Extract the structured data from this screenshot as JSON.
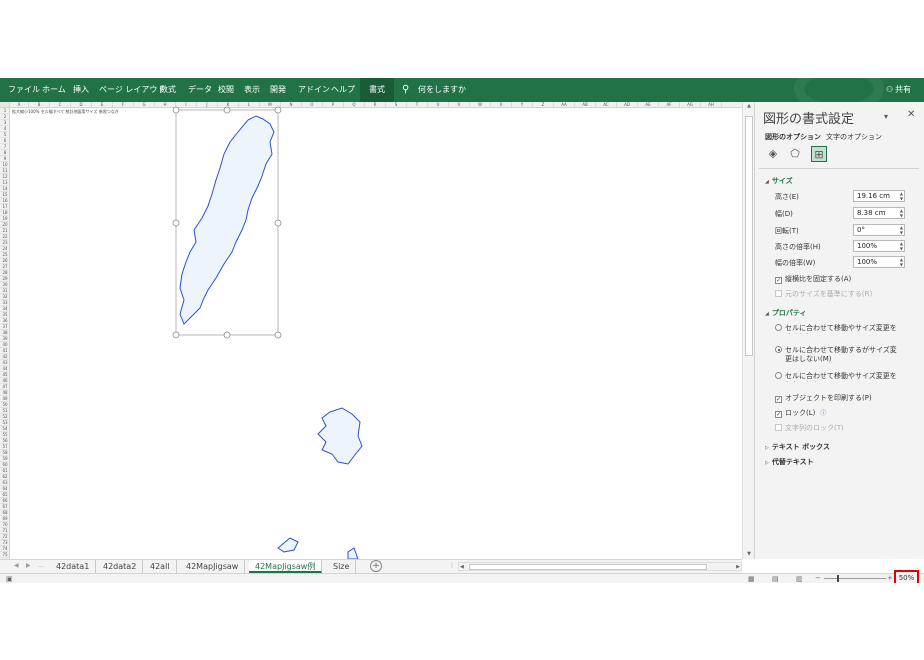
{
  "ribbon": {
    "tabs": [
      "ファイル",
      "ホーム",
      "挿入",
      "ページ レイアウト",
      "数式",
      "データ",
      "校閲",
      "表示",
      "開発",
      "アドイン",
      "ヘルプ",
      "書式"
    ],
    "active_tab": "書式",
    "tell_me": "何をしますか",
    "share": "共有",
    "accent_color": "#217346"
  },
  "sheet": {
    "columns": [
      "A",
      "B",
      "C",
      "D",
      "E",
      "F",
      "G",
      "H",
      "I",
      "J",
      "K",
      "L",
      "M",
      "N",
      "O",
      "P",
      "Q",
      "R",
      "S",
      "T",
      "U",
      "V",
      "W",
      "X",
      "Y",
      "Z",
      "AA",
      "AB",
      "AC",
      "AD",
      "AE",
      "AF",
      "AG",
      "AH"
    ],
    "note": "拡大縮小100%  セル幅すべて  統計地図用サイズ  参照つなぎ"
  },
  "pane": {
    "title": "図形の書式設定",
    "tabs": [
      "図形のオプション",
      "文字のオプション"
    ],
    "icons": [
      "fill-line-icon",
      "effects-icon",
      "size-properties-icon"
    ],
    "size_section": "サイズ",
    "height_label": "高さ(E)",
    "height_value": "19.16 cm",
    "width_label": "幅(D)",
    "width_value": "8.38 cm",
    "rotation_label": "回転(T)",
    "rotation_value": "0°",
    "scale_h_label": "高さの倍率(H)",
    "scale_h_value": "100%",
    "scale_w_label": "幅の倍率(W)",
    "scale_w_value": "100%",
    "lock_aspect": "縦横比を固定する(A)",
    "relative_original": "元のサイズを基準にする(R)",
    "properties_section": "プロパティ",
    "radio_1": "セルに合わせて移動やサイズ変更をする(S)",
    "radio_2": "セルに合わせて移動するがサイズ変更はしない(M)",
    "radio_3": "セルに合わせて移動やサイズ変更をしない(D)",
    "print_object": "オブジェクトを印刷する(P)",
    "lock": "ロック(L)",
    "lock_text": "文字列のロック(T)",
    "textbox_section": "テキスト ボックス",
    "alt_text_section": "代替テキスト"
  },
  "sheet_tabs": [
    "42data1",
    "42data2",
    "42all",
    "42MapJigsaw",
    "42MapJigsaw例",
    "Size"
  ],
  "active_sheet": "42MapJigsaw例",
  "status": {
    "zoom_percent": "50%",
    "zoom_level": 0.5
  }
}
